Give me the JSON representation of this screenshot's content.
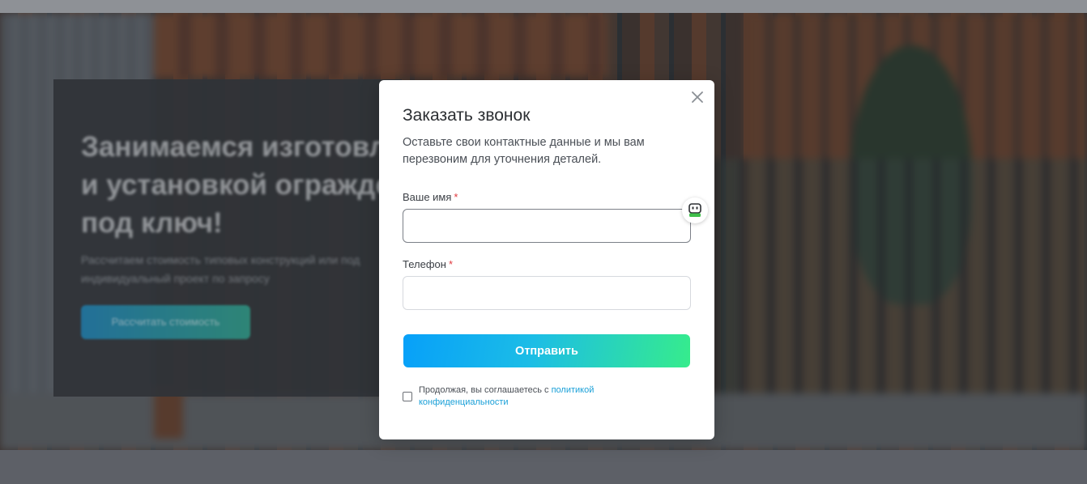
{
  "background": {
    "hero_title": "Занимаемся изготовлением\nи установкой ограждений\nпод ключ!",
    "hero_subtitle": "Рассчитаем стоимость типовых конструкций или под\nиндивидуальный проект по запросу",
    "hero_button": "Рассчитать стоимость"
  },
  "modal": {
    "title": "Заказать звонок",
    "description": "Оставьте свои контактные данные и мы вам перезвоним для уточнения деталей.",
    "close_icon": "close-icon",
    "fields": {
      "name": {
        "label": "Ваше имя",
        "required_mark": "*",
        "value": "",
        "placeholder": ""
      },
      "phone": {
        "label": "Телефон",
        "required_mark": "*",
        "value": "",
        "placeholder": ""
      }
    },
    "autofill_icon": "password-manager-icon",
    "submit_label": "Отправить",
    "consent": {
      "text": "Продолжая, вы соглашаетесь с ",
      "link_text": "политикой конфиденциальности",
      "checked": false
    }
  },
  "colors": {
    "accent_gradient_start": "#07a0f9",
    "accent_gradient_end": "#36ec8c",
    "link": "#1aa0d8",
    "required": "#e0393e"
  }
}
